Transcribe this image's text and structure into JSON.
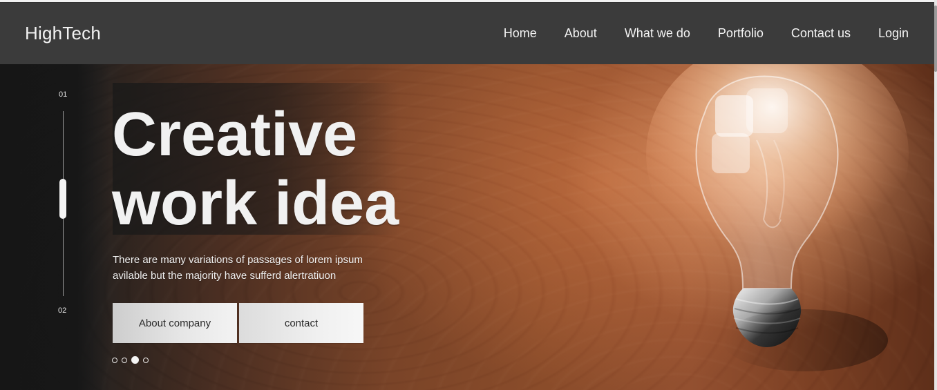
{
  "header": {
    "brand": "HighTech",
    "nav": [
      "Home",
      "About",
      "What we do",
      "Portfolio",
      "Contact us",
      "Login"
    ]
  },
  "hero": {
    "headline_lines": [
      "Creative",
      "work idea"
    ],
    "subtext_lines": [
      "There are many variations of passages of lorem ipsum",
      "avilable but the majority have sufferd alertratiuon"
    ],
    "buttons": {
      "about": "About company",
      "contact": "contact"
    }
  },
  "slider": {
    "index_top": "01",
    "index_bottom": "02",
    "dots_count": 4,
    "active_dot": 3
  },
  "icons": {
    "bulb": "lightbulb-image",
    "slider_handle": "slider-handle"
  },
  "colors": {
    "header_bg": "#3b3b3b",
    "text_light": "#f2f2f2",
    "button_text": "#2a2a2a"
  }
}
